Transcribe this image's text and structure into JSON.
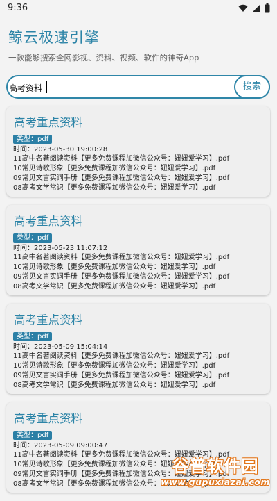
{
  "status_bar": {
    "time": "9:36",
    "icons": [
      "wifi-icon",
      "signal-icon",
      "battery-icon"
    ]
  },
  "app": {
    "title": "鲸云极速引擎",
    "subtitle": "一款能够搜索全网影视、资料、视频、软件的神奇App",
    "accent_color": "#2c84a7"
  },
  "search": {
    "value": "高考资料",
    "button_label": "搜索"
  },
  "results": [
    {
      "title": "高考重点资料",
      "type_label": "类型：pdf",
      "time_label": "时间：",
      "time": "2023-05-30 19:00:28",
      "files": [
        "11高中名著阅读资料【更多免费课程加微信公众号：妞妞爱学习】.pdf",
        "10常见诗歌形象【更多免费课程加微信公众号：妞妞爱学习】.pdf",
        "09常见文言实词手册【更多免费课程加微信公众号：妞妞爱学习】.pdf",
        "08高考文学常识【更多免费课程加微信公众号：妞妞爱学习】.pdf"
      ]
    },
    {
      "title": "高考重点资料",
      "type_label": "类型：pdf",
      "time_label": "时间：",
      "time": "2023-05-23 11:07:12",
      "files": [
        "11高中名著阅读资料【更多免费课程加微信公众号：妞妞爱学习】.pdf",
        "10常见诗歌形象【更多免费课程加微信公众号：妞妞爱学习】.pdf",
        "09常见文言实词手册【更多免费课程加微信公众号：妞妞爱学习】.pdf",
        "08高考文学常识【更多免费课程加微信公众号：妞妞爱学习】.pdf"
      ]
    },
    {
      "title": "高考重点资料",
      "type_label": "类型：pdf",
      "time_label": "时间：",
      "time": "2023-05-09 15:04:14",
      "files": [
        "11高中名著阅读资料【更多免费课程加微信公众号：妞妞爱学习】.pdf",
        "10常见诗歌形象【更多免费课程加微信公众号：妞妞爱学习】.pdf",
        "09常见文言实词手册【更多免费课程加微信公众号：妞妞爱学习】.pdf",
        "08高考文学常识【更多免费课程加微信公众号：妞妞爱学习】.pdf"
      ]
    },
    {
      "title": "高考重点资料",
      "type_label": "类型：pdf",
      "time_label": "时间：",
      "time": "2023-05-09 09:00:47",
      "files": [
        "11高中名著阅读资料【更多免费课程加微信公众号：妞妞爱学习】.pdf",
        "10常见诗歌形象【更多免费课程加微信公众号：妞妞爱学习】.pdf",
        "09常见文言实词手册【更多免费课程加微信公众号：妞妞爱学习】.pdf",
        "08高考文学常识【更多免费课程加微信公众号：妞妞爱学习】.pdf"
      ]
    }
  ],
  "watermark": {
    "main": "谷普软件园",
    "sub": "www.gupuxiazai.com"
  }
}
